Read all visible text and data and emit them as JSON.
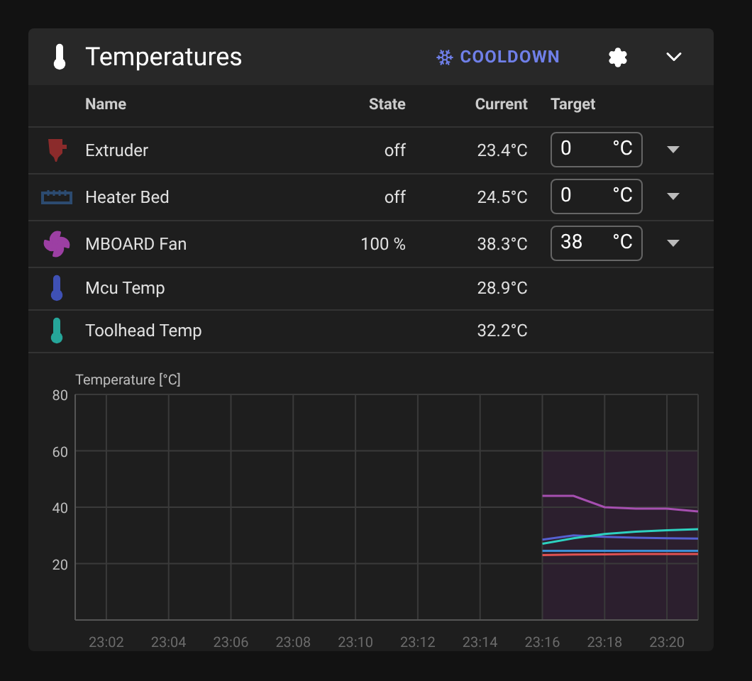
{
  "panel": {
    "title": "Temperatures",
    "cooldown_label": "COOLDOWN"
  },
  "table": {
    "columns": [
      "Name",
      "State",
      "Current",
      "Target"
    ],
    "rows": [
      {
        "kind": "extruder",
        "color": "#8b2b2b",
        "name": "Extruder",
        "state": "off",
        "current": "23.4°C",
        "target": "0",
        "unit": "°C"
      },
      {
        "kind": "bed",
        "color": "#2c4b70",
        "name": "Heater Bed",
        "state": "off",
        "current": "24.5°C",
        "target": "0",
        "unit": "°C"
      },
      {
        "kind": "fan",
        "color": "#9c3fa3",
        "name": "MBOARD Fan",
        "state": "100 %",
        "current": "38.3°C",
        "target": "38",
        "unit": "°C"
      },
      {
        "kind": "thermometer",
        "color": "#3f51b5",
        "name": "Mcu Temp",
        "current": "28.9°C"
      },
      {
        "kind": "thermometer",
        "color": "#26a69a",
        "name": "Toolhead Temp",
        "current": "32.2°C"
      }
    ]
  },
  "chart_data": {
    "type": "line",
    "ylabel": "Temperature [°C]",
    "categories": [
      null,
      "23:02",
      null,
      "23:04",
      null,
      "23:06",
      null,
      "23:08",
      null,
      "23:10",
      null,
      "23:12",
      null,
      "23:14",
      null,
      "23:16",
      null,
      "23:18",
      null,
      "23:20",
      null
    ],
    "series": [
      {
        "color": "#e05252",
        "values": [
          null,
          null,
          null,
          null,
          null,
          null,
          null,
          null,
          null,
          null,
          null,
          null,
          null,
          null,
          null,
          23,
          23.2,
          23.3,
          23.4,
          23.4,
          23.4
        ]
      },
      {
        "color": "#3d8fd6",
        "values": [
          null,
          null,
          null,
          null,
          null,
          null,
          null,
          null,
          null,
          null,
          null,
          null,
          null,
          null,
          null,
          24.5,
          24.5,
          24.5,
          24.5,
          24.5,
          24.5
        ]
      },
      {
        "color": "#a64fb0",
        "values": [
          null,
          null,
          null,
          null,
          null,
          null,
          null,
          null,
          null,
          null,
          null,
          null,
          null,
          null,
          null,
          44,
          44,
          40,
          39.5,
          39.5,
          38.5
        ]
      },
      {
        "color": "#5560d0",
        "values": [
          null,
          null,
          null,
          null,
          null,
          null,
          null,
          null,
          null,
          null,
          null,
          null,
          null,
          null,
          null,
          28.5,
          30,
          29.5,
          29.2,
          29,
          28.9
        ]
      },
      {
        "color": "#2ed1c0",
        "values": [
          null,
          null,
          null,
          null,
          null,
          null,
          null,
          null,
          null,
          null,
          null,
          null,
          null,
          null,
          null,
          27,
          29,
          30.5,
          31.3,
          31.8,
          32.2
        ]
      }
    ],
    "grid": true,
    "ylim": [
      0,
      80
    ],
    "yticks": [
      20,
      40,
      60,
      80
    ]
  }
}
